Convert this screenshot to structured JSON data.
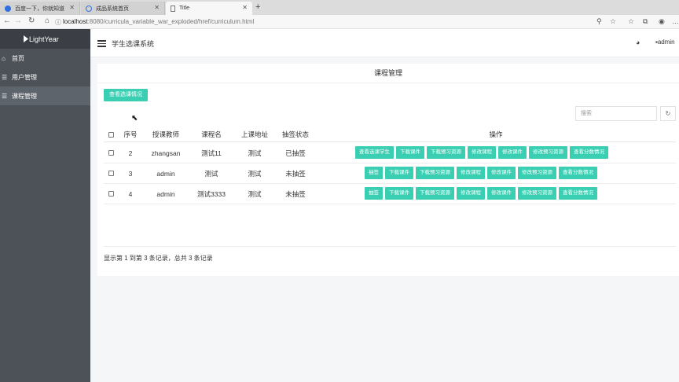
{
  "browser": {
    "tabs": [
      {
        "label": "百度一下，你就知道",
        "active": false
      },
      {
        "label": "成品系统首页",
        "active": false
      },
      {
        "label": "Title",
        "active": true
      }
    ],
    "new_tab": "+",
    "url_host": "localhost",
    "url_rest": ":8080/curricula_variable_war_exploded/href/curriculum.html"
  },
  "sidebar": {
    "logo": "LightYear",
    "items": [
      {
        "label": "首页",
        "icon": "home-icon"
      },
      {
        "label": "用户管理",
        "icon": "menu-icon"
      },
      {
        "label": "课程管理",
        "icon": "menu-icon"
      }
    ]
  },
  "header": {
    "title": "学生选课系统",
    "user": "admin"
  },
  "page": {
    "title": "课程管理",
    "view_button": "查看选课情况",
    "search_placeholder": "搜索"
  },
  "table": {
    "columns": [
      "序号",
      "授课教师",
      "课程名",
      "上课地址",
      "抽签状态",
      "操作"
    ],
    "rows": [
      {
        "id": "2",
        "teacher": "zhangsan",
        "course": "测试11",
        "addr": "测试",
        "status": "已抽签",
        "actions": [
          "查看选课学生",
          "下载课件",
          "下载预习资源",
          "修改课程",
          "修改课件",
          "修改预习资源",
          "查看分数情况"
        ]
      },
      {
        "id": "3",
        "teacher": "admin",
        "course": "测试",
        "addr": "测试",
        "status": "未抽签",
        "actions": [
          "抽签",
          "下载课件",
          "下载预习资源",
          "修改课程",
          "修改课件",
          "修改预习资源",
          "查看分数情况"
        ]
      },
      {
        "id": "4",
        "teacher": "admin",
        "course": "测试3333",
        "addr": "测试",
        "status": "未抽签",
        "actions": [
          "抽签",
          "下载课件",
          "下载预习资源",
          "修改课程",
          "修改课件",
          "修改预习资源",
          "查看分数情况"
        ]
      }
    ],
    "footer": "显示第 1 到第 3 条记录，总共 3 条记录"
  },
  "colors": {
    "accent": "#3acfb3",
    "sidebar": "#4d5259"
  }
}
